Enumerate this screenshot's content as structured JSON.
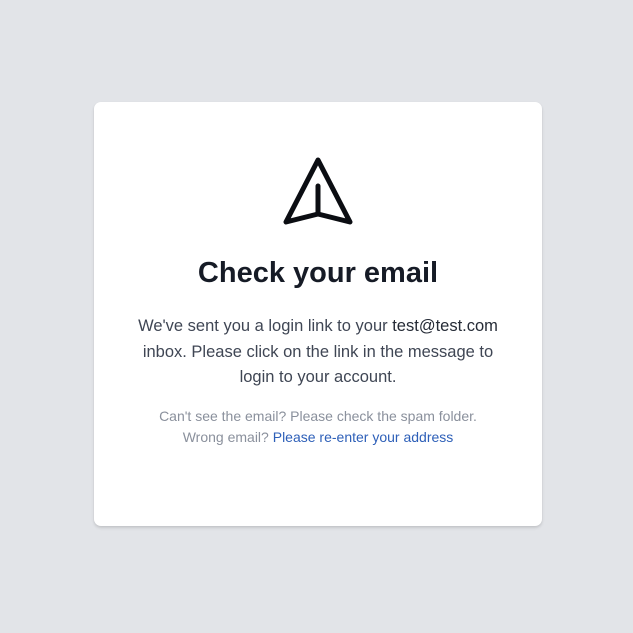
{
  "card": {
    "icon": "paper-plane-icon",
    "title": "Check your email",
    "message": {
      "prefix": "We've sent you a login link to your",
      "email": "test@test.com",
      "suffix": "inbox. Please click on the link in the message to login to your account."
    },
    "hint": {
      "line1": "Can't see the email? Please check the spam folder.",
      "line2_prefix": "Wrong email?",
      "reenter_link": "Please re-enter your address"
    }
  },
  "colors": {
    "background": "#e2e4e8",
    "card": "#ffffff",
    "title": "#161b26",
    "body_text": "#3f4654",
    "muted_text": "#8a909c",
    "link": "#2d5fb8"
  }
}
